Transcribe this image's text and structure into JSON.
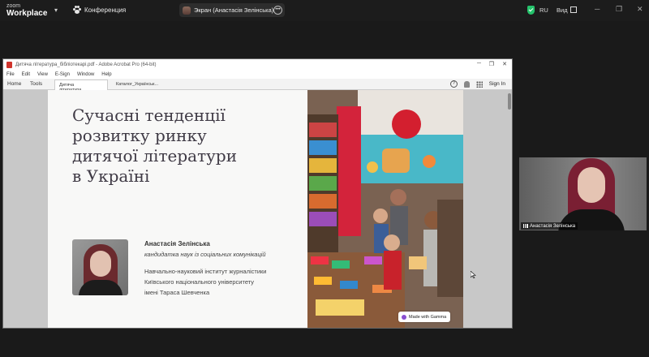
{
  "zoom": {
    "logo_line1": "zoom",
    "logo_line2": "Workplace",
    "meeting_label": "Конференция",
    "share_label": "Экран (Анастасія Зелінська)",
    "more_label": "•••",
    "lang": "RU",
    "view_label": "Вид"
  },
  "acrobat": {
    "window_title": "Дитяча література_бібліотекарі.pdf - Adobe Acrobat Pro (64-bit)",
    "menu": [
      "File",
      "Edit",
      "View",
      "E-Sign",
      "Window",
      "Help"
    ],
    "home_tab": "Home",
    "tools_tab": "Tools",
    "doc_tab_1": "Дитяча література_...",
    "doc_tab_2": "Каталог_Українськ...",
    "sign_in": "Sign In"
  },
  "slide": {
    "title_lines": [
      "Сучасні тенденції",
      "розвитку ринку",
      "дитячої літератури",
      "в Україні"
    ],
    "author_name": "Анастасія Зелінська",
    "author_degree": "кандидатка наук із соціальних комунікацій",
    "institution_lines": [
      "Навчально-науковий інститут журналістики",
      "Київського національного університету",
      "імені Тараса Шевченка"
    ],
    "badge_text": "Made with Gamma"
  },
  "participant": {
    "name": "Анастасія Зелінська"
  },
  "colors": {
    "zoom_bg": "#1a1a1a",
    "shield_green": "#25c26b",
    "slide_title": "#3f3a45",
    "acrobat_red": "#d0342c"
  }
}
